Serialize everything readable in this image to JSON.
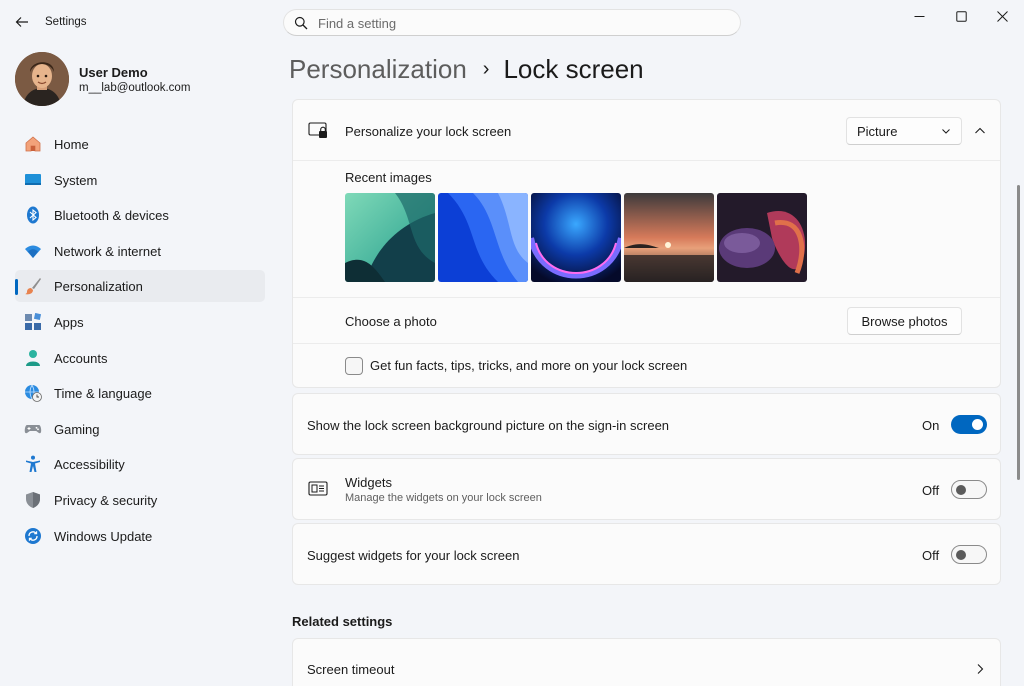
{
  "window": {
    "title": "Settings"
  },
  "search": {
    "placeholder": "Find a setting"
  },
  "user": {
    "name": "User Demo",
    "email": "m__lab@outlook.com"
  },
  "nav": {
    "items": [
      {
        "label": "Home",
        "icon": "home-icon"
      },
      {
        "label": "System",
        "icon": "system-icon"
      },
      {
        "label": "Bluetooth & devices",
        "icon": "bluetooth-icon"
      },
      {
        "label": "Network & internet",
        "icon": "wifi-icon"
      },
      {
        "label": "Personalization",
        "icon": "brush-icon",
        "active": true
      },
      {
        "label": "Apps",
        "icon": "apps-icon"
      },
      {
        "label": "Accounts",
        "icon": "accounts-icon"
      },
      {
        "label": "Time & language",
        "icon": "globe-clock-icon"
      },
      {
        "label": "Gaming",
        "icon": "gamepad-icon"
      },
      {
        "label": "Accessibility",
        "icon": "accessibility-icon"
      },
      {
        "label": "Privacy & security",
        "icon": "shield-icon"
      },
      {
        "label": "Windows Update",
        "icon": "update-icon"
      }
    ]
  },
  "breadcrumb": {
    "parent": "Personalization",
    "separator": "›",
    "current": "Lock screen"
  },
  "lock": {
    "title": "Personalize your lock screen",
    "dropdown_value": "Picture",
    "recent_label": "Recent images",
    "choose_label": "Choose a photo",
    "browse_label": "Browse photos",
    "fun_facts_label": "Get fun facts, tips, tricks, and more on your lock screen"
  },
  "signin_row": {
    "title": "Show the lock screen background picture on the sign-in screen",
    "state": "On"
  },
  "widgets_row": {
    "title": "Widgets",
    "subtitle": "Manage the widgets on your lock screen",
    "state": "Off"
  },
  "suggest_row": {
    "title": "Suggest widgets for your lock screen",
    "state": "Off"
  },
  "related": {
    "title": "Related settings",
    "screen_timeout": "Screen timeout"
  },
  "colors": {
    "accent": "#0067c0"
  }
}
